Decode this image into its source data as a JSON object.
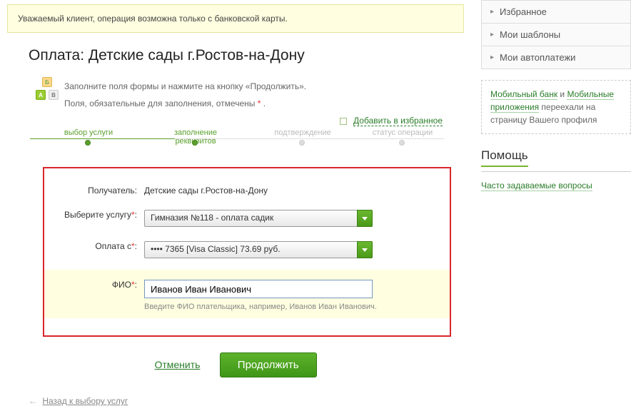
{
  "alert": {
    "text": "Уважаемый клиент, операция возможна только с банковской карты."
  },
  "page_title": "Оплата: Детские сады г.Ростов-на-Дону",
  "intro": {
    "line1": "Заполните поля формы и нажмите на кнопку «Продолжить».",
    "line2_a": "Поля, обязательные для заполнения, отмечены ",
    "line2_b": "*",
    "line2_c": " ."
  },
  "fav_link": "Добавить в избранное",
  "steps": {
    "s1": "выбор услуги",
    "s2": "заполнение реквизитов",
    "s3": "подтверждение",
    "s4": "статус операции"
  },
  "form": {
    "recipient_label": "Получатель:",
    "recipient_value": "Детские сады г.Ростов-на-Дону",
    "service_label": "Выберите услугу",
    "service_value": "Гимназия №118 - оплата садик",
    "payfrom_label": "Оплата с",
    "payfrom_value": "•••• 7365 [Visa Classic] 73.69 руб.",
    "fio_label": "ФИО",
    "fio_value": "Иванов Иван Иванович",
    "fio_hint": "Введите ФИО плательщика, например, Иванов Иван Иванович."
  },
  "actions": {
    "cancel": "Отменить",
    "continue": "Продолжить"
  },
  "back_link": "Назад к выбору услуг",
  "sidebar": {
    "items": [
      "Избранное",
      "Мои шаблоны",
      "Мои автоплатежи"
    ],
    "info_a": "Мобильный банк",
    "info_and": " и ",
    "info_b": "Мобильные приложения",
    "info_rest": " переехали на страницу Вашего профиля",
    "help_title": "Помощь",
    "faq": "Часто задаваемые вопросы"
  }
}
